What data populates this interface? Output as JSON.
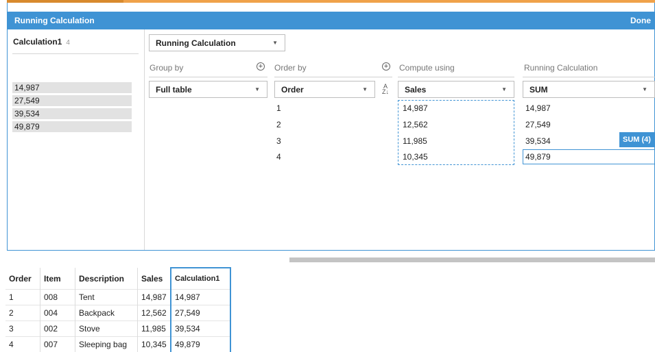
{
  "header": {
    "title": "Running Calculation",
    "done_label": "Done"
  },
  "calculation": {
    "name": "Calculation1",
    "count": "4",
    "values": [
      "14,987",
      "27,549",
      "39,534",
      "49,879"
    ]
  },
  "calc_type_dropdown": {
    "value": "Running Calculation"
  },
  "group_by": {
    "label": "Group by",
    "value": "Full table"
  },
  "order_by": {
    "label": "Order by",
    "value": "Order",
    "sort_icon": "sort-ascending-icon",
    "values": [
      "1",
      "2",
      "3",
      "4"
    ]
  },
  "compute_using": {
    "label": "Compute using",
    "value": "Sales",
    "values": [
      "14,987",
      "12,562",
      "11,985",
      "10,345"
    ]
  },
  "running_calc": {
    "label": "Running Calculation",
    "value": "SUM",
    "values": [
      "14,987",
      "27,549",
      "39,534",
      "49,879"
    ],
    "tag": "SUM (4)"
  },
  "table": {
    "headers": [
      "Order",
      "Item",
      "Description",
      "Sales",
      "Calculation1"
    ],
    "rows": [
      [
        "1",
        "008",
        "Tent",
        "14,987",
        "14,987"
      ],
      [
        "2",
        "004",
        "Backpack",
        "12,562",
        "27,549"
      ],
      [
        "3",
        "002",
        "Stove",
        "11,985",
        "39,534"
      ],
      [
        "4",
        "007",
        "Sleeping bag",
        "10,345",
        "49,879"
      ]
    ]
  },
  "colors": {
    "accent": "#3f93d4",
    "top_bar": "#f0a24a"
  }
}
